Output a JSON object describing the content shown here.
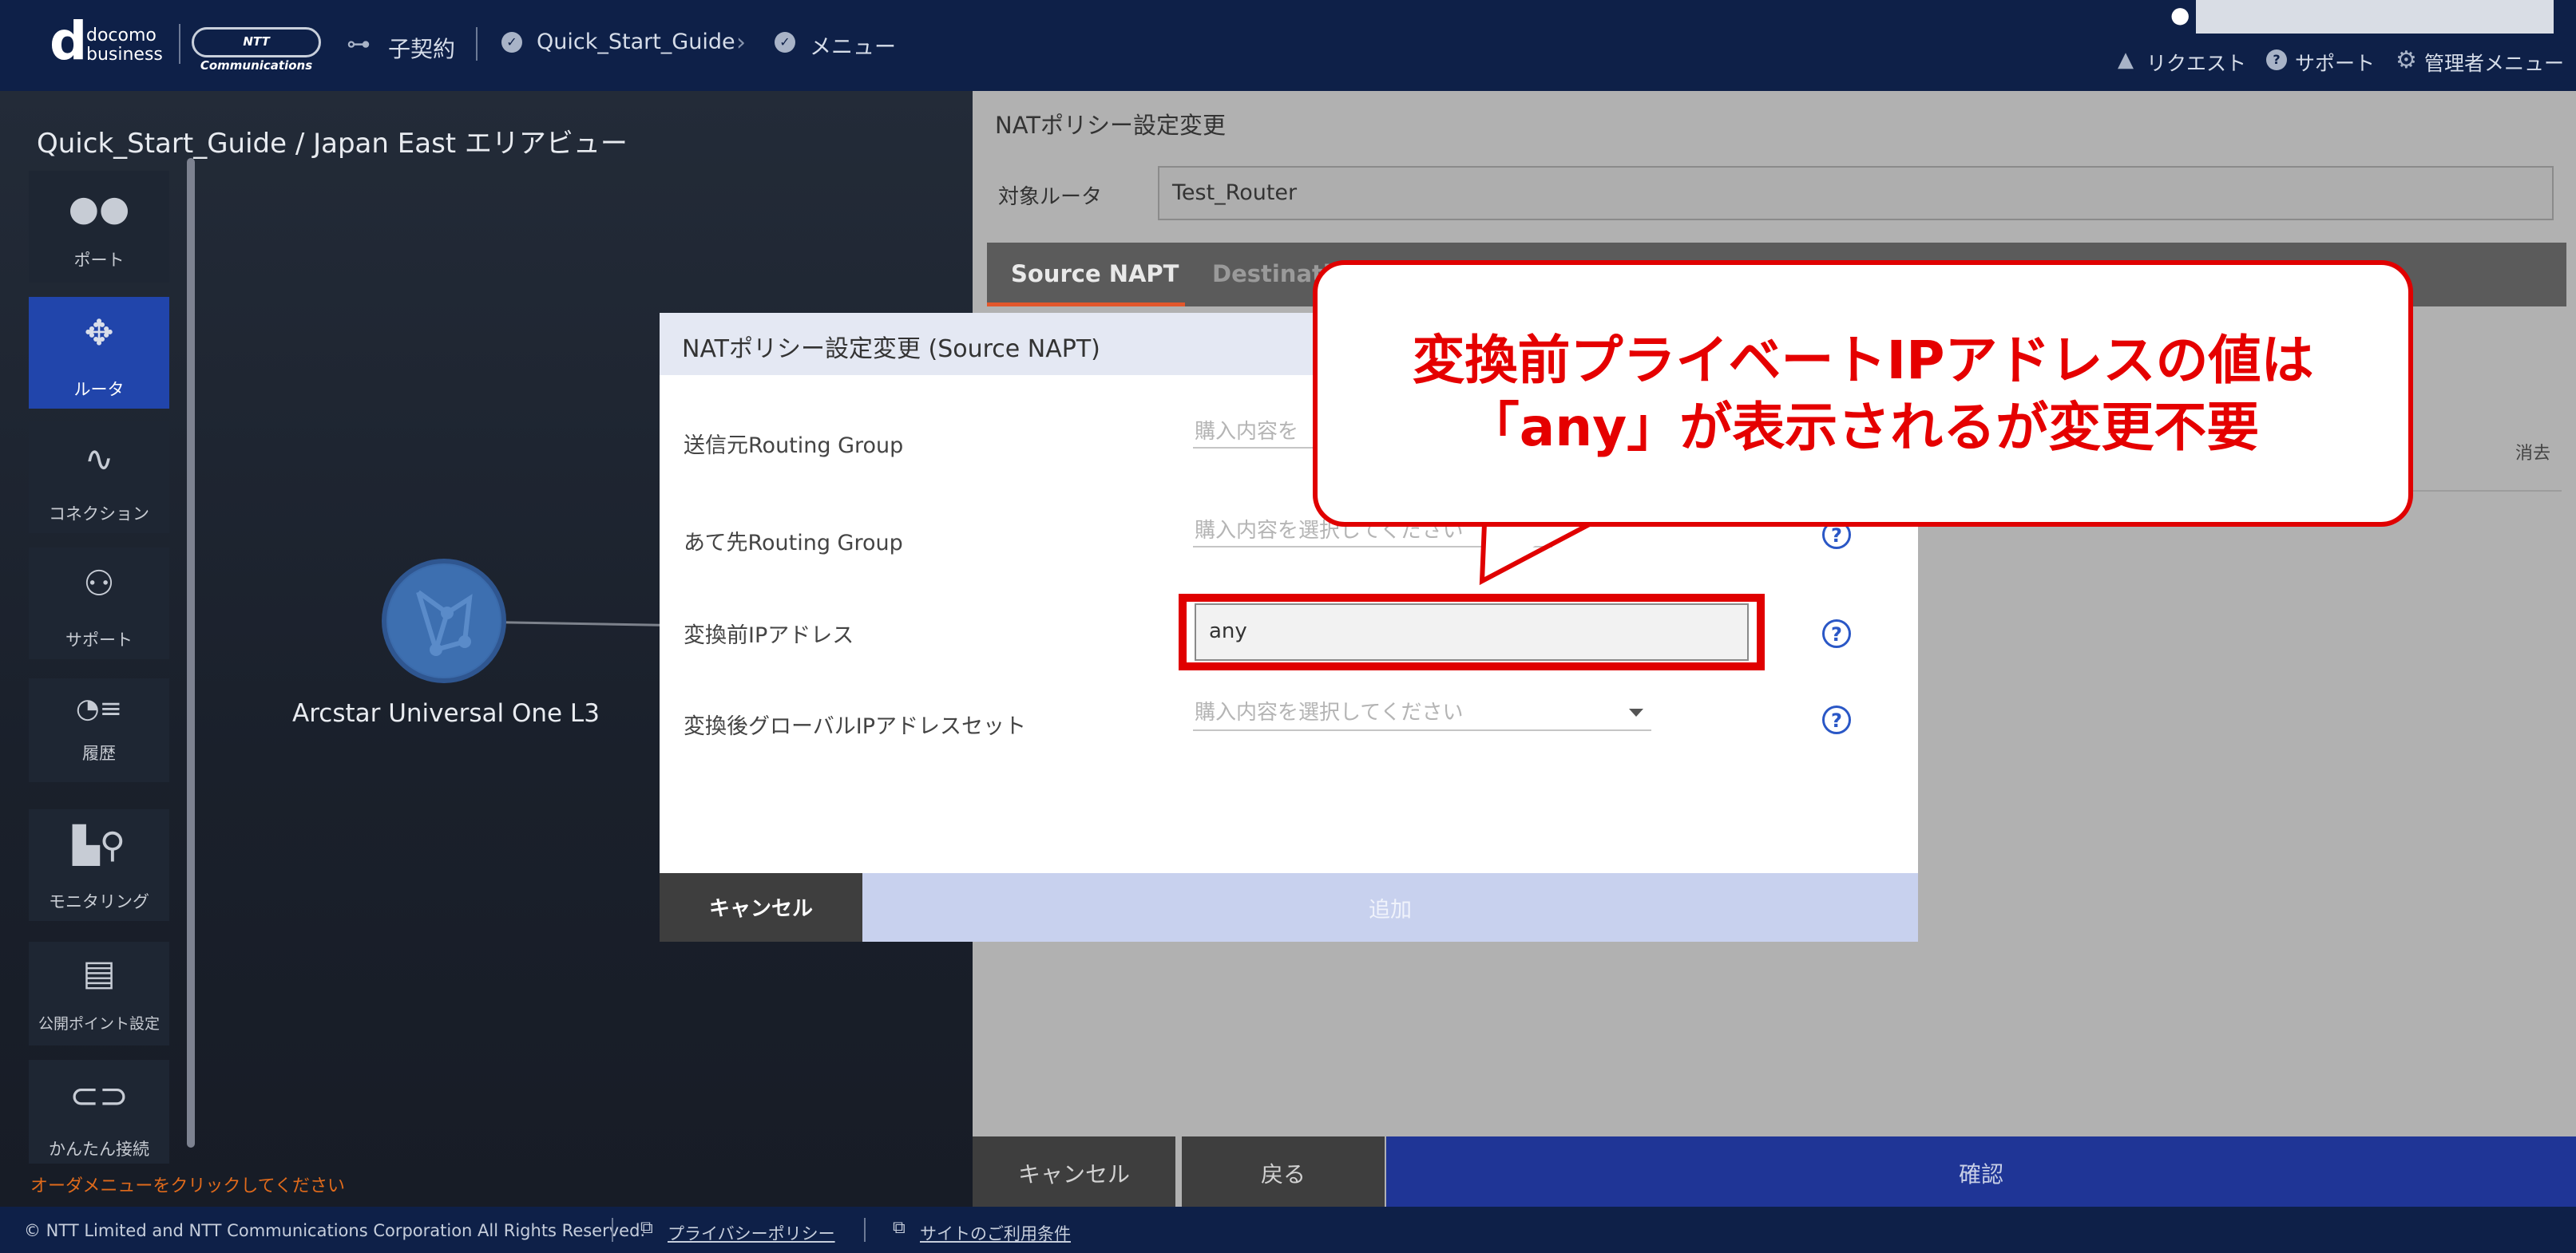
{
  "header": {
    "brand_line1": "docomo",
    "brand_line2": "business",
    "ntt_logo": "NTT Communications",
    "contract_label": "子契約",
    "breadcrumb_project": "Quick_Start_Guide",
    "breadcrumb_menu": "メニュー",
    "request_label": "リクエスト",
    "support_label": "サポート",
    "admin_menu_label": "管理者メニュー"
  },
  "left": {
    "view_title": "Quick_Start_Guide / Japan East エリアビュー",
    "sidebar": [
      {
        "label": "ポート",
        "icon": "port-icon"
      },
      {
        "label": "ルータ",
        "icon": "router-icon"
      },
      {
        "label": "コネクション",
        "icon": "connection-icon"
      },
      {
        "label": "サポート",
        "icon": "support-user-icon"
      },
      {
        "label": "履歴",
        "icon": "history-icon"
      },
      {
        "label": "モニタリング",
        "icon": "monitoring-icon"
      },
      {
        "label": "公開ポイント設定",
        "icon": "public-point-icon"
      },
      {
        "label": "かんたん接続",
        "icon": "easy-connect-icon"
      }
    ],
    "network_node_label": "Arcstar Universal One L3",
    "order_hint": "オーダメニューをクリックしてください"
  },
  "right": {
    "panel_title": "NATポリシー設定変更",
    "target_router_label": "対象ルータ",
    "target_router_value": "Test_Router",
    "tabs": [
      "Source NAPT",
      "Destinatio"
    ],
    "delete_label": "消去",
    "cancel_label": "キャンセル",
    "back_label": "戻る",
    "confirm_label": "確認"
  },
  "modal": {
    "title": "NATポリシー設定変更 (Source NAPT)",
    "fields": [
      {
        "label": "送信元Routing Group",
        "placeholder": "購入内容を"
      },
      {
        "label": "あて先Routing Group",
        "placeholder": "購入内容を選択してください"
      },
      {
        "label": "変換前IPアドレス",
        "value": "any"
      },
      {
        "label": "変換後グローバルIPアドレスセット",
        "placeholder": "購入内容を選択してください"
      }
    ],
    "cancel_label": "キャンセル",
    "add_label": "追加"
  },
  "callout": {
    "line1": "変換前プライベートIPアドレスの値は",
    "line2": "「any」が表示されるが変更不要"
  },
  "footer": {
    "copyright": "© NTT Limited and NTT Communications Corporation All Rights Reserved.",
    "privacy_label": "プライバシーポリシー",
    "terms_label": "サイトのご利用条件"
  },
  "colors": {
    "header_bg": "#0e2048",
    "accent_blue": "#2145ab",
    "confirm_bg": "#1f3596",
    "callout_red": "#e50000",
    "tab_underline": "#e2572c",
    "hint_orange": "#e06a1b"
  }
}
